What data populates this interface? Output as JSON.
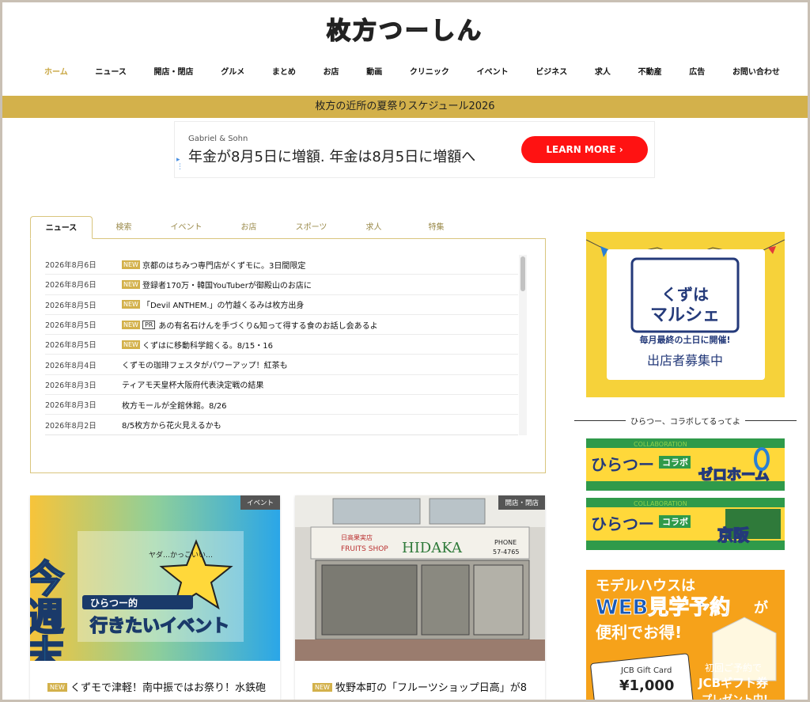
{
  "site": {
    "logo_text": "枚方つーしん"
  },
  "nav": {
    "items": [
      "ホーム",
      "ニュース",
      "開店・閉店",
      "グルメ",
      "まとめ",
      "お店",
      "動画",
      "クリニック",
      "イベント",
      "ビジネス",
      "求人",
      "不動産",
      "広告",
      "お問い合わせ"
    ],
    "active_index": 0
  },
  "banner": {
    "text": "枚方の近所の夏祭りスケジュール2026"
  },
  "ad": {
    "advertiser": "Gabriel & Sohn",
    "headline": "年金が8月5日に増額. 年金は8月5日に増額へ",
    "button_label": "LEARN MORE",
    "button_arrow": "›"
  },
  "tabs": {
    "items": [
      "ニュース",
      "検索",
      "イベント",
      "お店",
      "スポーツ",
      "求人",
      "特集"
    ],
    "active_index": 0
  },
  "news": [
    {
      "date": "2026年8月6日",
      "new": "NEW",
      "pr": "",
      "title": "京都のはちみつ専門店がくずモに。3日間限定"
    },
    {
      "date": "2026年8月6日",
      "new": "NEW",
      "pr": "",
      "title": "登録者170万・韓国YouTuberが御殿山のお店に"
    },
    {
      "date": "2026年8月5日",
      "new": "NEW",
      "pr": "",
      "title": "「Devil ANTHEM.」の竹越くるみは枚方出身"
    },
    {
      "date": "2026年8月5日",
      "new": "NEW",
      "pr": "PR",
      "title": "あの有名石けんを手づくり&知って得する食のお話し会あるよ"
    },
    {
      "date": "2026年8月5日",
      "new": "NEW",
      "pr": "",
      "title": "くずはに移動科学館くる。8/15・16"
    },
    {
      "date": "2026年8月4日",
      "new": "",
      "pr": "",
      "title": "くずモの珈琲フェスタがパワーアップ！紅茶も"
    },
    {
      "date": "2026年8月3日",
      "new": "",
      "pr": "",
      "title": "ティアモ天皇杯大阪府代表決定戦の結果"
    },
    {
      "date": "2026年8月3日",
      "new": "",
      "pr": "",
      "title": "枚方モールが全館休館。8/26"
    },
    {
      "date": "2026年8月2日",
      "new": "",
      "pr": "",
      "title": "8/5枚方から花火見えるかも"
    }
  ],
  "cards": [
    {
      "category": "イベント",
      "new": "NEW",
      "title": "くずモで津軽！南中振ではお祭り！水鉄砲",
      "image_text": {
        "big": "今週末",
        "sub": "ひらつー的",
        "main": "行きたいイベント",
        "bubble": "ヤダ…かっこいい…"
      }
    },
    {
      "category": "開店・閉店",
      "new": "NEW",
      "title": "牧野本町の「フルーツショップ日高」が8",
      "image_text": {
        "shop_jp": "日高果実店",
        "shop_en": "FRUITS SHOP",
        "sign": "HIDAKA",
        "phone": "PHONE",
        "phone_num": "57-4765"
      }
    }
  ],
  "sidebar": {
    "marche": {
      "title1": "くずは",
      "title2": "マルシェ",
      "sub": "毎月最終の土日に開催!",
      "recruit": "出店者募集中"
    },
    "collab_heading": "ひらつー、コラボしてるってよ",
    "collabs": [
      {
        "brand": "ひらつー",
        "label": "コラボ",
        "partner": "ゼロホーム",
        "strip": "COLLABORATION"
      },
      {
        "brand": "ひらつー",
        "label": "コラボ",
        "partner": "京阪",
        "strip": "COLLABORATION"
      }
    ],
    "model": {
      "line1": "モデルハウスは",
      "line2": "WEB見学予約",
      "line3": "が",
      "line4": "便利でお得!",
      "card_label": "JCB Gift Card",
      "card_value": "¥1,000",
      "promo1": "初回ご予約で",
      "promo2": "JCBギフト券",
      "promo3": "プレゼント中!"
    }
  },
  "colors": {
    "accent": "#d3b14b",
    "ad_button": "#ff1212"
  }
}
